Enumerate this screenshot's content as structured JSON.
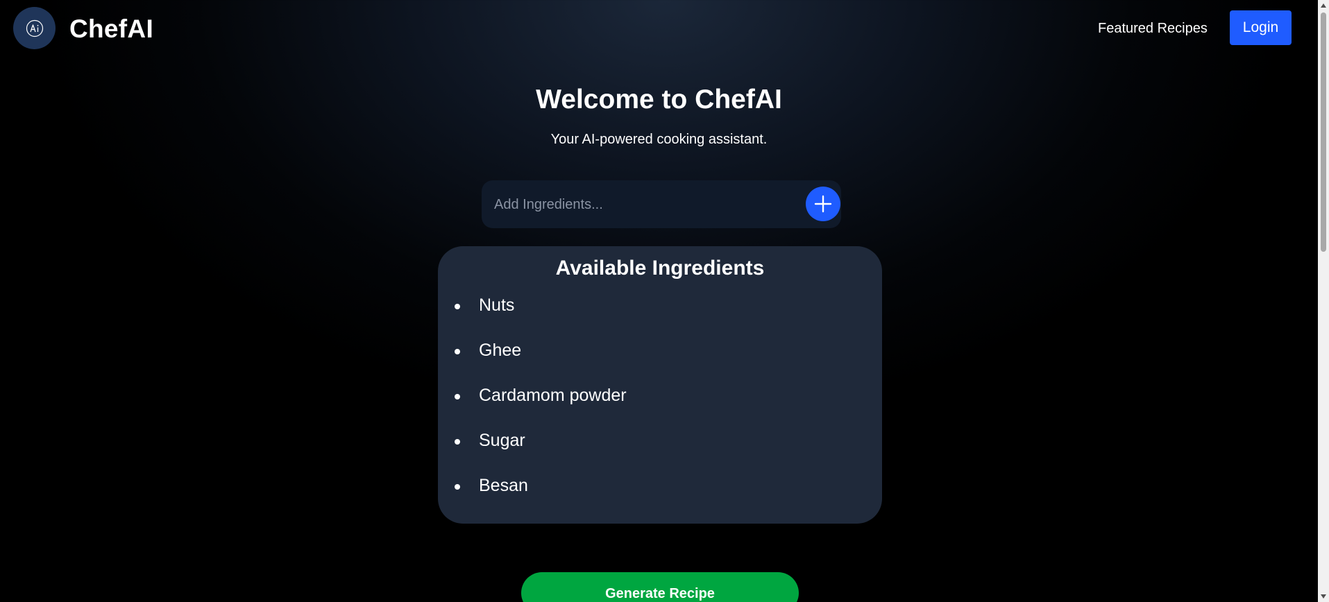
{
  "header": {
    "logo_icon": "ai-logo-icon",
    "logo_text": "ChefAI",
    "nav_featured": "Featured Recipes",
    "login_label": "Login"
  },
  "hero": {
    "title": "Welcome to ChefAI",
    "subtitle": "Your AI-powered cooking assistant."
  },
  "ingredient_input": {
    "value": "",
    "placeholder": "Add Ingredients...",
    "add_icon": "plus-icon"
  },
  "ingredients_card": {
    "title": "Available Ingredients",
    "items": [
      "Nuts",
      "Ghee",
      "Cardamom powder",
      "Sugar",
      "Besan"
    ]
  },
  "actions": {
    "generate_label": "Generate Recipe"
  },
  "colors": {
    "accent_blue": "#1f5cff",
    "generate_green": "#00a640",
    "card_bg": "#1f293a",
    "logo_badge": "#1f3559"
  }
}
